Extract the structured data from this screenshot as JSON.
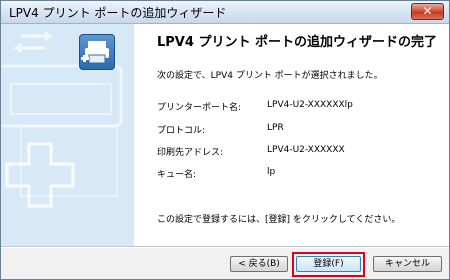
{
  "window": {
    "title": "LPV4 プリント ポートの追加ウィザード",
    "close_glyph": "✕"
  },
  "content": {
    "heading": "LPV4 プリント ポートの追加ウィザードの完了",
    "intro": "次の設定で、LPV4 プリント ポートが選択されました。",
    "settings": [
      {
        "label": "プリンターポート名:",
        "value": "LPV4-U2-XXXXXXlp"
      },
      {
        "label": "プロトコル:",
        "value": "LPR"
      },
      {
        "label": "印刷先アドレス:",
        "value": "LPV4-U2-XXXXXX"
      },
      {
        "label": "キュー名:",
        "value": "lp"
      }
    ],
    "footer": "この設定で登録するには、[登録] をクリックしてください。"
  },
  "buttons": {
    "back": "< 戻る(B)",
    "register": "登録(F)",
    "cancel": "キャンセル"
  },
  "colors": {
    "sidebar": "#d7e8f6",
    "highlight": "#e0001b"
  },
  "icons": {
    "sidebar_logo": "printer-port-icon",
    "close": "close-icon"
  }
}
